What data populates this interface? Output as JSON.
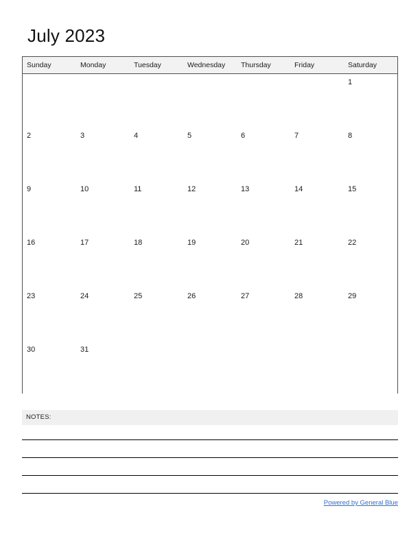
{
  "document": {
    "title": "July 2023",
    "month": "July",
    "year": "2023"
  },
  "calendar": {
    "weekday_headers": [
      "Sunday",
      "Monday",
      "Tuesday",
      "Wednesday",
      "Thursday",
      "Friday",
      "Saturday"
    ],
    "weeks": [
      [
        "",
        "",
        "",
        "",
        "",
        "",
        "1"
      ],
      [
        "2",
        "3",
        "4",
        "5",
        "6",
        "7",
        "8"
      ],
      [
        "9",
        "10",
        "11",
        "12",
        "13",
        "14",
        "15"
      ],
      [
        "16",
        "17",
        "18",
        "19",
        "20",
        "21",
        "22"
      ],
      [
        "23",
        "24",
        "25",
        "26",
        "27",
        "28",
        "29"
      ],
      [
        "30",
        "31",
        "",
        "",
        "",
        "",
        ""
      ]
    ]
  },
  "notes": {
    "label": "NOTES:",
    "line_count": 4
  },
  "footer": {
    "link_text": "Powered by General Blue"
  },
  "colors": {
    "header_background": "#f2f2f2",
    "notes_background": "#f0f0f0",
    "grid_border": "#4d4d4d",
    "link": "#2c6fd1",
    "text": "#1a1a1a",
    "page_background": "#ffffff"
  }
}
